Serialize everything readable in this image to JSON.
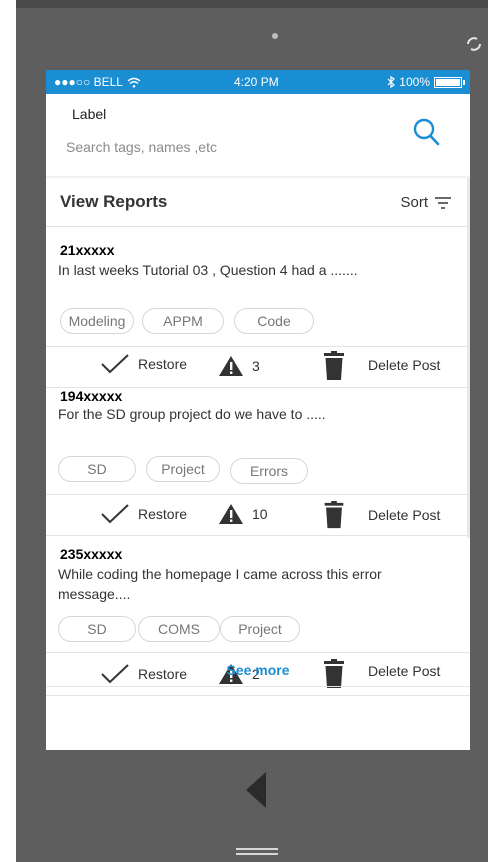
{
  "statusbar": {
    "carrier": "●●●○○ BELL",
    "time": "4:20 PM",
    "battery_text": "100%",
    "bluetooth": "bluetooth-icon",
    "wifi": "wifi-icon"
  },
  "search": {
    "label": "Label",
    "placeholder": "Search tags, names ,etc",
    "icon": "search-icon"
  },
  "reports": {
    "title": "View Reports",
    "sort_label": "Sort"
  },
  "posts": [
    {
      "id": "21xxxxx",
      "text": "In last weeks Tutorial 03 , Question 4 had a .......",
      "tags": [
        "Modeling",
        "APPM",
        "Code"
      ],
      "restore_label": "Restore",
      "report_count": "3",
      "delete_label": "Delete Post"
    },
    {
      "id": "194xxxxx",
      "text": "For the SD group project do we have to .....",
      "tags": [
        "SD",
        "Project",
        "Errors"
      ],
      "restore_label": "Restore",
      "report_count": "10",
      "delete_label": "Delete Post"
    },
    {
      "id": "235xxxxx",
      "text": "While coding the homepage I came across this error message....",
      "tags": [
        "SD",
        "COMS",
        "Project"
      ],
      "restore_label": "Restore",
      "report_count": "2",
      "delete_label": "Delete Post"
    }
  ],
  "see_more": "See more",
  "colors": {
    "accent": "#1a8ed2",
    "device": "#5e5e5e"
  }
}
